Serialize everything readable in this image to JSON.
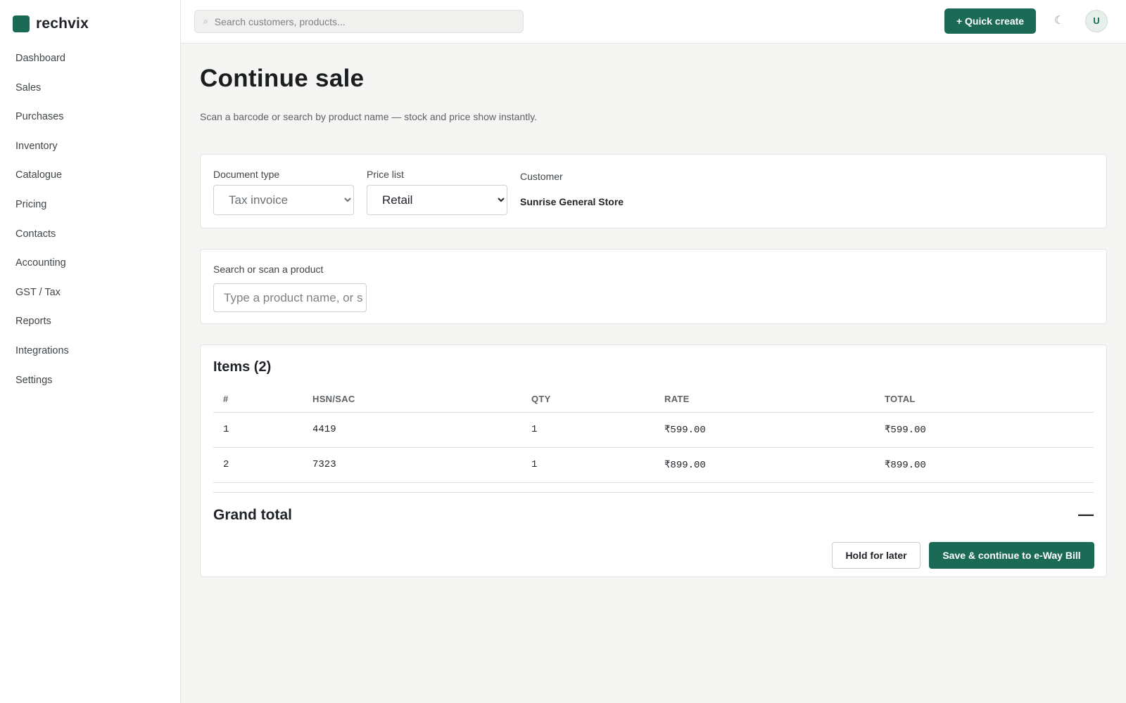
{
  "brand": {
    "name": "rechvix",
    "accent": "#1b6a55"
  },
  "sidebar": {
    "items": [
      {
        "label": "Dashboard"
      },
      {
        "label": "Sales"
      },
      {
        "label": "Purchases"
      },
      {
        "label": "Inventory"
      },
      {
        "label": "Catalogue"
      },
      {
        "label": "Pricing"
      },
      {
        "label": "Contacts"
      },
      {
        "label": "Accounting"
      },
      {
        "label": "GST / Tax"
      },
      {
        "label": "Reports"
      },
      {
        "label": "Integrations"
      },
      {
        "label": "Settings"
      }
    ]
  },
  "header": {
    "search_placeholder": "Search customers, products...",
    "search_icon": "⌕",
    "quick_create_label": "+ Quick create",
    "theme_icon": "☾",
    "avatar_initial": "U"
  },
  "page": {
    "title": "Continue sale",
    "subtitle": "Scan a barcode or search by product name — stock and price show instantly."
  },
  "doc_form": {
    "document_type_label": "Document type",
    "document_type_value": "Tax invoice",
    "price_list_label": "Price list",
    "price_list_value": "Retail",
    "customer_label": "Customer",
    "customer_name": "Sunrise General Store"
  },
  "product_search": {
    "label": "Search or scan a product",
    "placeholder": "Type a product name, or s"
  },
  "items": {
    "title": "Items (2)",
    "columns": [
      "#",
      "HSN/SAC",
      "QTY",
      "RATE",
      "TOTAL"
    ],
    "rows": [
      {
        "num": "1",
        "hsn": "4419",
        "qty": "1",
        "rate": "₹599.00",
        "total": "₹599.00"
      },
      {
        "num": "2",
        "hsn": "7323",
        "qty": "1",
        "rate": "₹899.00",
        "total": "₹899.00"
      }
    ],
    "grand_total_label": "Grand total",
    "grand_total_value": "—",
    "hold_label": "Hold for later",
    "save_label": "Save & continue to e-Way Bill"
  }
}
